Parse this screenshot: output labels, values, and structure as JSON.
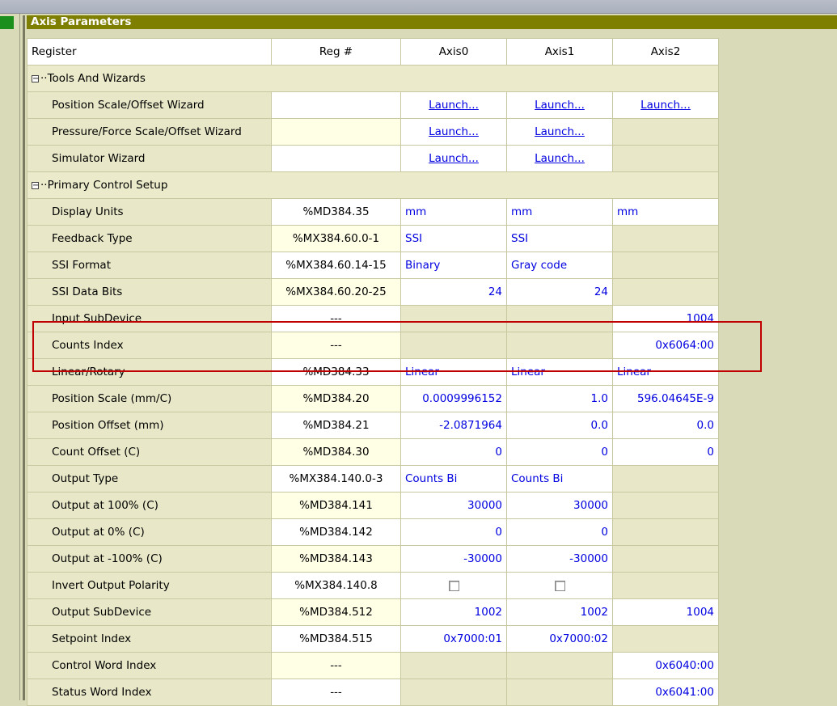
{
  "panel": {
    "title": "Axis Parameters"
  },
  "columns": [
    "Register",
    "Reg #",
    "Axis0",
    "Axis1",
    "Axis2"
  ],
  "groups": {
    "tools": {
      "label": "Tools And Wizards",
      "expander": "−",
      "rows": [
        {
          "name": "Position Scale/Offset Wizard",
          "reg": "",
          "a0": "Launch...",
          "a1": "Launch...",
          "a2": "Launch..."
        },
        {
          "name": "Pressure/Force Scale/Offset Wizard",
          "reg": "",
          "a0": "Launch...",
          "a1": "Launch...",
          "a2": ""
        },
        {
          "name": "Simulator Wizard",
          "reg": "",
          "a0": "Launch...",
          "a1": "Launch...",
          "a2": ""
        }
      ]
    },
    "primary": {
      "label": "Primary Control Setup",
      "expander": "−",
      "rows": [
        {
          "name": "Display Units",
          "reg": "%MD384.35",
          "a0": "mm",
          "a1": "mm",
          "a2": "mm"
        },
        {
          "name": "Feedback Type",
          "reg": "%MX384.60.0-1",
          "a0": "SSI",
          "a1": "SSI",
          "a2": ""
        },
        {
          "name": "SSI Format",
          "reg": "%MX384.60.14-15",
          "a0": "Binary",
          "a1": "Gray code",
          "a2": ""
        },
        {
          "name": "SSI Data Bits",
          "reg": "%MX384.60.20-25",
          "a0": "24",
          "a1": "24",
          "a2": ""
        },
        {
          "name": "Input SubDevice",
          "reg": "---",
          "a0": "",
          "a1": "",
          "a2": "1004"
        },
        {
          "name": "Counts Index",
          "reg": "---",
          "a0": "",
          "a1": "",
          "a2": "0x6064:00"
        },
        {
          "name": "Linear/Rotary",
          "reg": "%MD384.33",
          "a0": "Linear",
          "a1": "Linear",
          "a2": "Linear"
        },
        {
          "name": "Position Scale (mm/C)",
          "reg": "%MD384.20",
          "a0": "0.0009996152",
          "a1": "1.0",
          "a2": "596.04645E-9"
        },
        {
          "name": "Position Offset (mm)",
          "reg": "%MD384.21",
          "a0": "-2.0871964",
          "a1": "0.0",
          "a2": "0.0"
        },
        {
          "name": "Count Offset (C)",
          "reg": "%MD384.30",
          "a0": "0",
          "a1": "0",
          "a2": "0"
        },
        {
          "name": "Output Type",
          "reg": "%MX384.140.0-3",
          "a0": "Counts Bi",
          "a1": "Counts Bi",
          "a2": ""
        },
        {
          "name": "Output at 100% (C)",
          "reg": "%MD384.141",
          "a0": "30000",
          "a1": "30000",
          "a2": ""
        },
        {
          "name": "Output at 0% (C)",
          "reg": "%MD384.142",
          "a0": "0",
          "a1": "0",
          "a2": ""
        },
        {
          "name": "Output at -100% (C)",
          "reg": "%MD384.143",
          "a0": "-30000",
          "a1": "-30000",
          "a2": ""
        },
        {
          "name": "Invert Output Polarity",
          "reg": "%MX384.140.8",
          "a0_checked": false,
          "a1_checked": false,
          "a2": ""
        },
        {
          "name": "Output SubDevice",
          "reg": "%MD384.512",
          "a0": "1002",
          "a1": "1002",
          "a2": "1004"
        },
        {
          "name": "Setpoint Index",
          "reg": "%MD384.515",
          "a0": "0x7000:01",
          "a1": "0x7000:02",
          "a2": ""
        },
        {
          "name": "Control Word Index",
          "reg": "---",
          "a0": "",
          "a1": "",
          "a2": "0x6040:00"
        },
        {
          "name": "Status Word Index",
          "reg": "---",
          "a0": "",
          "a1": "",
          "a2": "0x6041:00"
        }
      ]
    }
  },
  "colors": {
    "header_bar": "#7e7e00",
    "value_text": "#0000e0",
    "highlight": "#c00000",
    "background": "#d9dab8"
  }
}
